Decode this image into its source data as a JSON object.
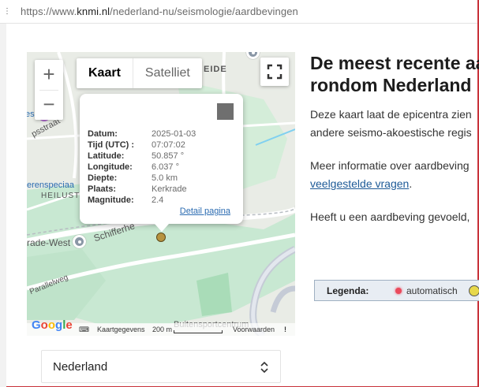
{
  "browser": {
    "url_prefix": "https://www.",
    "url_domain": "knmi.nl",
    "url_path": "/nederland-nu/seismologie/aardbevingen"
  },
  "map": {
    "zoom_in": "+",
    "zoom_out": "−",
    "type_map": "Kaart",
    "type_satellite": "Satelliet",
    "labels": {
      "eide": "EIDE",
      "erenspecia": "erenspeciaa",
      "heilust": "HEILUST",
      "psstraat": "psstraat",
      "rade_west": "rade-West",
      "schifferh": "Schifferhe",
      "parallelweg": "Parallelweg",
      "buitensport": "Buitensportcentrum"
    },
    "popup": {
      "rows": [
        {
          "key": "Datum:",
          "value": "2025-01-03"
        },
        {
          "key": "Tijd (UTC) :",
          "value": "07:07:02"
        },
        {
          "key": "Latitude:",
          "value": "50.857 °"
        },
        {
          "key": "Longitude:",
          "value": "6.037 °"
        },
        {
          "key": "Diepte:",
          "value": "5.0 km"
        },
        {
          "key": "Plaats:",
          "value": "Kerkrade"
        },
        {
          "key": "Magnitude:",
          "value": "2.4"
        }
      ],
      "detail_link": "Detail pagina"
    },
    "footer": {
      "google": [
        "G",
        "o",
        "o",
        "g",
        "l",
        "e"
      ],
      "kaartgegevens": "Kaartgegevens",
      "scale": "200 m",
      "voorwaarden": "Voorwaarden"
    }
  },
  "region_select": {
    "value": "Nederland",
    "chevron": "⌃⌄"
  },
  "content": {
    "heading_line1": "De meest recente aa",
    "heading_line2": "rondom Nederland",
    "para1_line1": "Deze kaart laat de epicentra zien",
    "para1_line2": "andere seismo-akoestische regis",
    "para2_line1": "Meer informatie over aardbeving",
    "para2_link": "veelgestelde vragen",
    "para2_end": ".",
    "para3": "Heeft u een aardbeving gevoeld,"
  },
  "legend": {
    "title": "Legenda:",
    "item1": "automatisch"
  }
}
